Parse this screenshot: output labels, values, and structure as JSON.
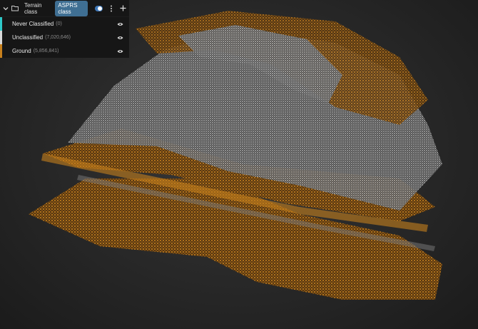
{
  "toolbar": {
    "tab_terrain": "Terrain class",
    "tab_asprs": "ASPRS class"
  },
  "classes": [
    {
      "label": "Never Classified",
      "count": "(0)",
      "color": "#2ec8c8"
    },
    {
      "label": "Unclassified",
      "count": "(7,020,646)",
      "color": "#d8d8d8"
    },
    {
      "label": "Ground",
      "count": "(5,856,841)",
      "color": "#c7801d"
    }
  ],
  "colors": {
    "ground": "#c7801d",
    "unclassified": "#d8d8d8",
    "accent": "#3f6f93"
  }
}
